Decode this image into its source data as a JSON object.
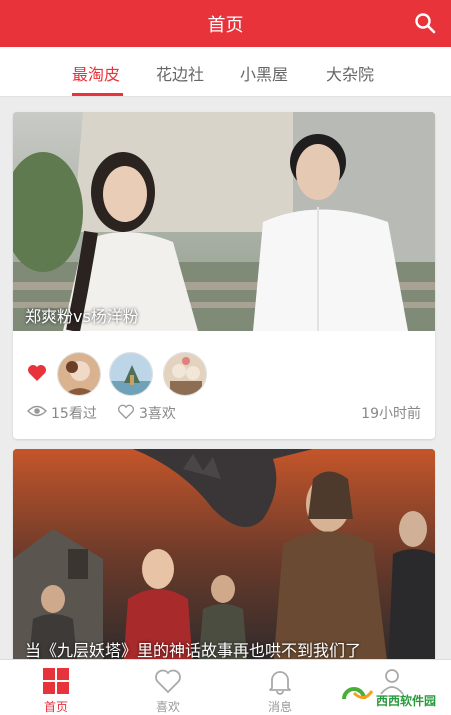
{
  "header": {
    "title": "首页",
    "search_icon": "search-icon"
  },
  "tabs": [
    {
      "label": "最淘皮",
      "active": true
    },
    {
      "label": "花边社",
      "active": false
    },
    {
      "label": "小黑屋",
      "active": false
    },
    {
      "label": "大杂院",
      "active": false
    }
  ],
  "cards": [
    {
      "caption": "郑爽粉vs杨洋粉",
      "liked": true,
      "views": "15看过",
      "likes": "3喜欢",
      "time": "19小时前"
    },
    {
      "caption": "当《九层妖塔》里的神话故事再也哄不到我们了"
    }
  ],
  "bottom_nav": [
    {
      "label": "首页",
      "icon": "home-grid-icon",
      "active": true
    },
    {
      "label": "喜欢",
      "icon": "heart-icon",
      "active": false
    },
    {
      "label": "消息",
      "icon": "bell-icon",
      "active": false
    },
    {
      "label": "",
      "icon": "user-icon",
      "active": false
    }
  ],
  "watermark": {
    "text": "西西软件园"
  },
  "colors": {
    "brand": "#e8333b",
    "background": "#ececec",
    "muted": "#888888"
  }
}
